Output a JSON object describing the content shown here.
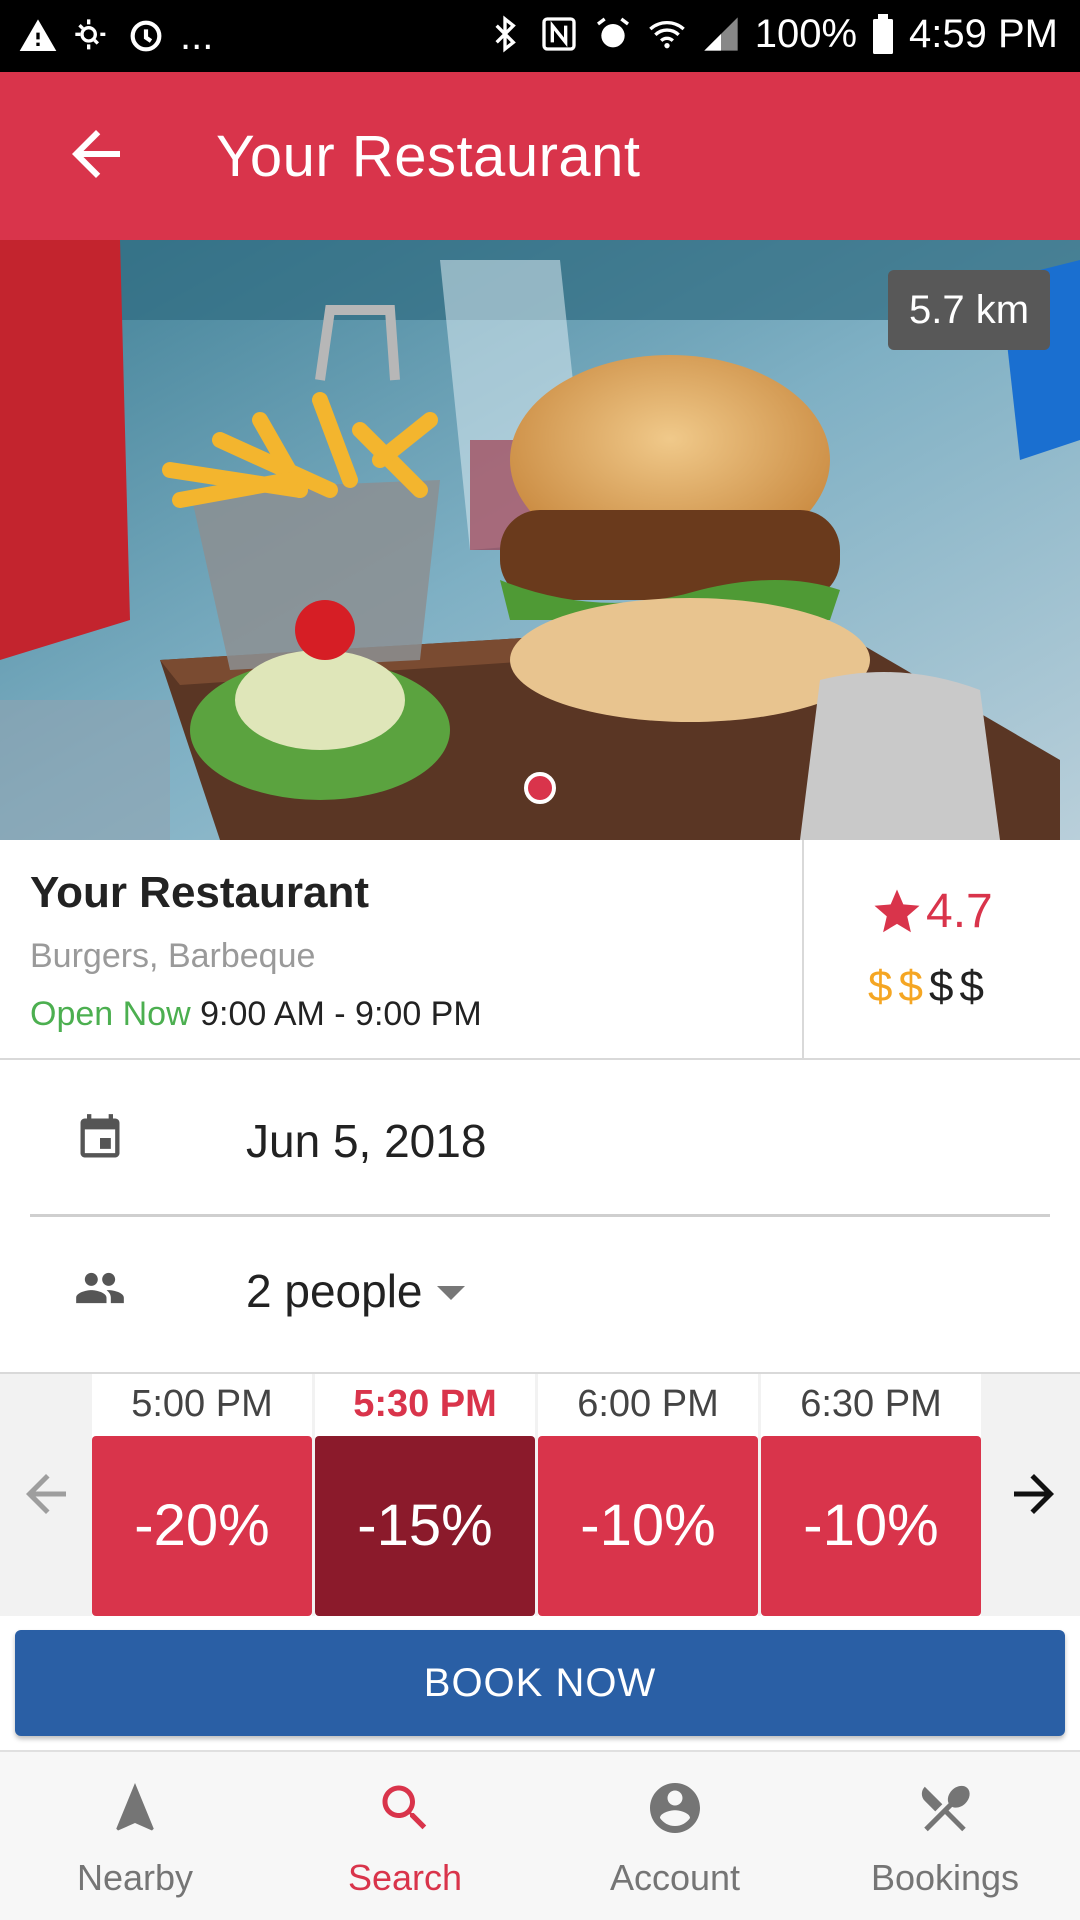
{
  "status_bar": {
    "left_icons": [
      "warning-icon",
      "weather-icon",
      "sync-icon",
      "more-notifications-icon"
    ],
    "overflow_text": "...",
    "right_icons": [
      "bluetooth-icon",
      "nfc-icon",
      "alarm-icon",
      "wifi-icon",
      "signal-icon",
      "battery-icon"
    ],
    "battery": "100%",
    "time": "4:59 PM"
  },
  "app_bar": {
    "title": "Your Restaurant",
    "back_icon": "arrow-back-icon"
  },
  "hero": {
    "distance": "5.7 km",
    "image_count": 1,
    "current_image": 1
  },
  "restaurant": {
    "name": "Your Restaurant",
    "cuisine": "Burgers, Barbeque",
    "open_status": "Open Now",
    "hours": "9:00 AM - 9:00 PM",
    "rating": "4.7",
    "price_symbols": [
      "$",
      "$",
      "$",
      "$"
    ],
    "price_level": 2,
    "colors": {
      "open": "#4caf50",
      "price_active": "#f5a623",
      "rating": "#d9344b"
    }
  },
  "booking": {
    "date": "Jun 5, 2018",
    "date_icon": "calendar-icon",
    "party_size": "2 people",
    "party_icon": "people-icon"
  },
  "time_slots": [
    {
      "time": "5:00 PM",
      "discount": "-20%",
      "selected": false
    },
    {
      "time": "5:30 PM",
      "discount": "-15%",
      "selected": true
    },
    {
      "time": "6:00 PM",
      "discount": "-10%",
      "selected": false
    },
    {
      "time": "6:30 PM",
      "discount": "-10%",
      "selected": false
    }
  ],
  "actions": {
    "book_label": "BOOK NOW"
  },
  "bottom_nav": [
    {
      "label": "Nearby",
      "icon": "navigation-icon",
      "active": false
    },
    {
      "label": "Search",
      "icon": "search-icon",
      "active": true
    },
    {
      "label": "Account",
      "icon": "account-icon",
      "active": false
    },
    {
      "label": "Bookings",
      "icon": "cutlery-icon",
      "active": false
    }
  ],
  "theme": {
    "primary": "#d9344b",
    "primary_dark": "#8b1a2b",
    "button": "#2a5fa5"
  }
}
